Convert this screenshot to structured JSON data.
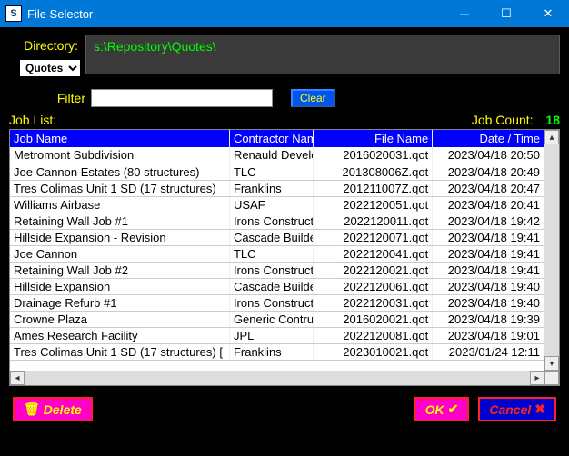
{
  "window": {
    "title": "File Selector"
  },
  "directory": {
    "label": "Directory:",
    "path": "s:\\Repository\\Quotes\\",
    "select_value": "Quotes"
  },
  "filter": {
    "label": "Filter",
    "value": "",
    "clear_label": "Clear"
  },
  "list": {
    "label": "Job List:",
    "count_label": "Job Count:",
    "count_value": "18"
  },
  "columns": {
    "c0": "Job Name",
    "c1": "Contractor Nam",
    "c2": "File Name",
    "c3": "Date / Time"
  },
  "rows": [
    {
      "job": "Metromont Subdivision",
      "contractor": "Renauld Develo",
      "file": "2016020031.qot",
      "date": "2023/04/18 20:50"
    },
    {
      "job": "Joe Cannon Estates (80 structures)",
      "contractor": "TLC",
      "file": "201308006Z.qot",
      "date": "2023/04/18 20:49"
    },
    {
      "job": "Tres Colimas Unit 1 SD (17 structures)",
      "contractor": "Franklins",
      "file": "201211007Z.qot",
      "date": "2023/04/18 20:47"
    },
    {
      "job": "Williams Airbase",
      "contractor": "USAF",
      "file": "2022120051.qot",
      "date": "2023/04/18 20:41"
    },
    {
      "job": "Retaining Wall Job #1",
      "contractor": "Irons Construct",
      "file": "2022120011.qot",
      "date": "2023/04/18 19:42"
    },
    {
      "job": "Hillside Expansion - Revision",
      "contractor": "Cascade Builde",
      "file": "2022120071.qot",
      "date": "2023/04/18 19:41"
    },
    {
      "job": "Joe Cannon",
      "contractor": "TLC",
      "file": "2022120041.qot",
      "date": "2023/04/18 19:41"
    },
    {
      "job": "Retaining Wall Job #2",
      "contractor": "Irons Construct",
      "file": "2022120021.qot",
      "date": "2023/04/18 19:41"
    },
    {
      "job": "Hillside Expansion",
      "contractor": "Cascade Builde",
      "file": "2022120061.qot",
      "date": "2023/04/18 19:40"
    },
    {
      "job": "Drainage Refurb #1",
      "contractor": "Irons Construct",
      "file": "2022120031.qot",
      "date": "2023/04/18 19:40"
    },
    {
      "job": "Crowne Plaza",
      "contractor": "Generic Contru",
      "file": "2016020021.qot",
      "date": "2023/04/18 19:39"
    },
    {
      "job": "Ames Research Facility",
      "contractor": "JPL",
      "file": "2022120081.qot",
      "date": "2023/04/18 19:01"
    },
    {
      "job": "Tres Colimas Unit 1 SD (17 structures) [",
      "contractor": "Franklins",
      "file": "2023010021.qot",
      "date": "2023/01/24 12:11"
    }
  ],
  "buttons": {
    "delete": "Delete",
    "ok": "OK",
    "cancel": "Cancel"
  }
}
